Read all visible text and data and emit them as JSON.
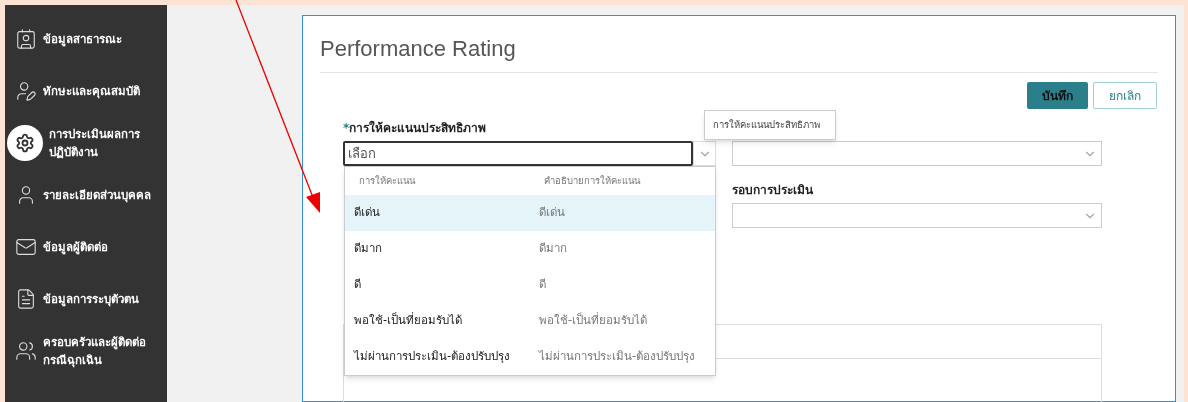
{
  "sidebar": {
    "items": [
      {
        "label": "ข้อมูลสาธารณะ",
        "selected": false
      },
      {
        "label": "ทักษะและคุณสมบัติ",
        "selected": false
      },
      {
        "label": "การประเมินผลการปฏิบัติงาน",
        "selected": true
      },
      {
        "label": "รายละเอียดส่วนบุคคล",
        "selected": false
      },
      {
        "label": "ข้อมูลผู้ติดต่อ",
        "selected": false
      },
      {
        "label": "ข้อมูลการระบุตัวตน",
        "selected": false
      },
      {
        "label": "ครอบครัวและผู้ติดต่อกรณีฉุกเฉิน",
        "selected": false
      }
    ]
  },
  "form": {
    "title": "Performance Rating",
    "buttons": [
      {
        "label": "บันทึก",
        "kind": "primary"
      },
      {
        "label": "ยกเลิก",
        "kind": "secondary"
      }
    ],
    "rating_field": {
      "required_mark": "*",
      "label": "การให้คะแนนประสิทธิภาพ",
      "placeholder": "เลือก",
      "focused": true
    },
    "tooltip": "การให้คะแนนประสิทธิภาพ",
    "cycle_field": {
      "label": "รอบการประเมิน"
    },
    "dropdown": {
      "columns": [
        "การให้คะแนน",
        "คำอธิบายการให้คะแนน"
      ],
      "rows": [
        {
          "cells": [
            "ดีเด่น",
            "ดีเด่น"
          ],
          "selected": true
        },
        {
          "cells": [
            "ดีมาก",
            "ดีมาก"
          ],
          "selected": false
        },
        {
          "cells": [
            "ดี",
            "ดี"
          ],
          "selected": false
        },
        {
          "cells": [
            "พอใช้-เป็นที่ยอมรับได้",
            "พอใช้-เป็นที่ยอมรับได้"
          ],
          "selected": false
        },
        {
          "cells": [
            "ไม่ผ่านการประเมิน-ต้องปรับปรุง",
            "ไม่ผ่านการประเมิน-ต้องปรับปรุง"
          ],
          "selected": false
        }
      ]
    }
  }
}
